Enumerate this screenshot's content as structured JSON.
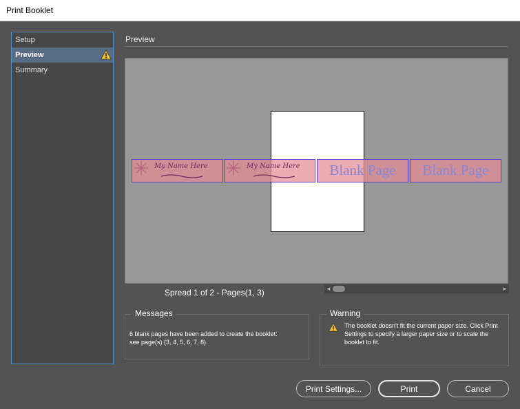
{
  "window": {
    "title": "Print Booklet"
  },
  "sidebar": {
    "items": [
      {
        "label": "Setup"
      },
      {
        "label": "Preview"
      },
      {
        "label": "Summary"
      }
    ]
  },
  "preview": {
    "section_title": "Preview",
    "pages": [
      {
        "type": "card",
        "text": "My Name Here"
      },
      {
        "type": "card",
        "text": "My Name Here"
      },
      {
        "type": "blank",
        "text": "Blank Page"
      },
      {
        "type": "blank",
        "text": "Blank Page"
      }
    ],
    "spread_label": "Spread 1 of 2 - Pages(1, 3)",
    "scroll_left_arrow": "◂",
    "scroll_right_arrow": "▸"
  },
  "messages": {
    "title": "Messages",
    "text": "6 blank pages have been added to create the booklet: see page(s) (3, 4, 5, 6, 7, 8)."
  },
  "warning": {
    "title": "Warning",
    "text": "The booklet doesn't fit the current paper size. Click Print Settings to specify a larger paper size or to scale the booklet to fit."
  },
  "buttons": {
    "print_settings": "Print Settings...",
    "print": "Print",
    "cancel": "Cancel"
  },
  "colors": {
    "dialog_bg": "#535353",
    "selection_accent": "#586c86",
    "focus_border": "#4f8fd2",
    "warning_yellow": "#f2c12e",
    "page_overlay": "#e48c96",
    "page_border": "#5a3bd8"
  }
}
